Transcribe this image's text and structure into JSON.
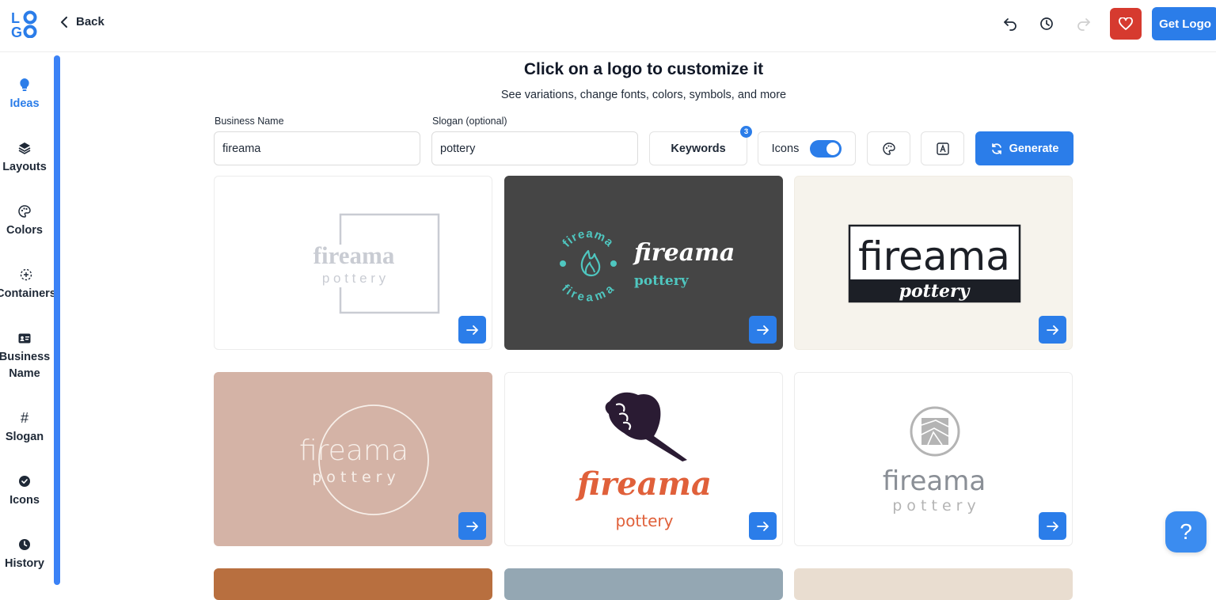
{
  "app": {
    "logo_letters": "LOGO",
    "back_label": "Back",
    "get_logo_label": "Get Logo",
    "brand_color": "#2b7de9",
    "favorite_color": "#d63a2f"
  },
  "sidebar": {
    "items": [
      {
        "label": "Ideas",
        "icon": "lightbulb-icon",
        "active": true
      },
      {
        "label": "Layouts",
        "icon": "layers-icon"
      },
      {
        "label": "Colors",
        "icon": "palette-icon"
      },
      {
        "label": "Containers",
        "icon": "dashed-circle-icon"
      },
      {
        "label": "Business Name",
        "icon": "id-card-icon"
      },
      {
        "label": "Slogan",
        "icon": "hash-icon"
      },
      {
        "label": "Icons",
        "icon": "check-badge-icon"
      },
      {
        "label": "History",
        "icon": "clock-icon"
      }
    ]
  },
  "main": {
    "title": "Click on a logo to customize it",
    "subtitle": "See variations, change fonts, colors, symbols, and more",
    "business_name_label": "Business Name",
    "business_name_value": "fireama",
    "slogan_label": "Slogan (optional)",
    "slogan_value": "pottery",
    "keywords_label": "Keywords",
    "keywords_count": "3",
    "icons_label": "Icons",
    "icons_enabled": true,
    "generate_label": "Generate"
  },
  "cards": [
    {
      "name": "fireama",
      "slogan": "p o t t e r y",
      "bg": "#ffffff"
    },
    {
      "name": "fireama",
      "slogan": "pottery",
      "ring_text": "fireama",
      "bg": "#454545"
    },
    {
      "name": "fireama",
      "slogan": "pottery",
      "bg": "#f6f3ec"
    },
    {
      "name": "fireama",
      "slogan": "p o t t e r y",
      "bg": "#d4b3a6"
    },
    {
      "name": "fireama",
      "slogan": "pottery",
      "bg": "#ffffff"
    },
    {
      "name": "fireama",
      "slogan": "p o t t e r y",
      "bg": "#ffffff"
    }
  ],
  "help": {
    "label": "?"
  }
}
